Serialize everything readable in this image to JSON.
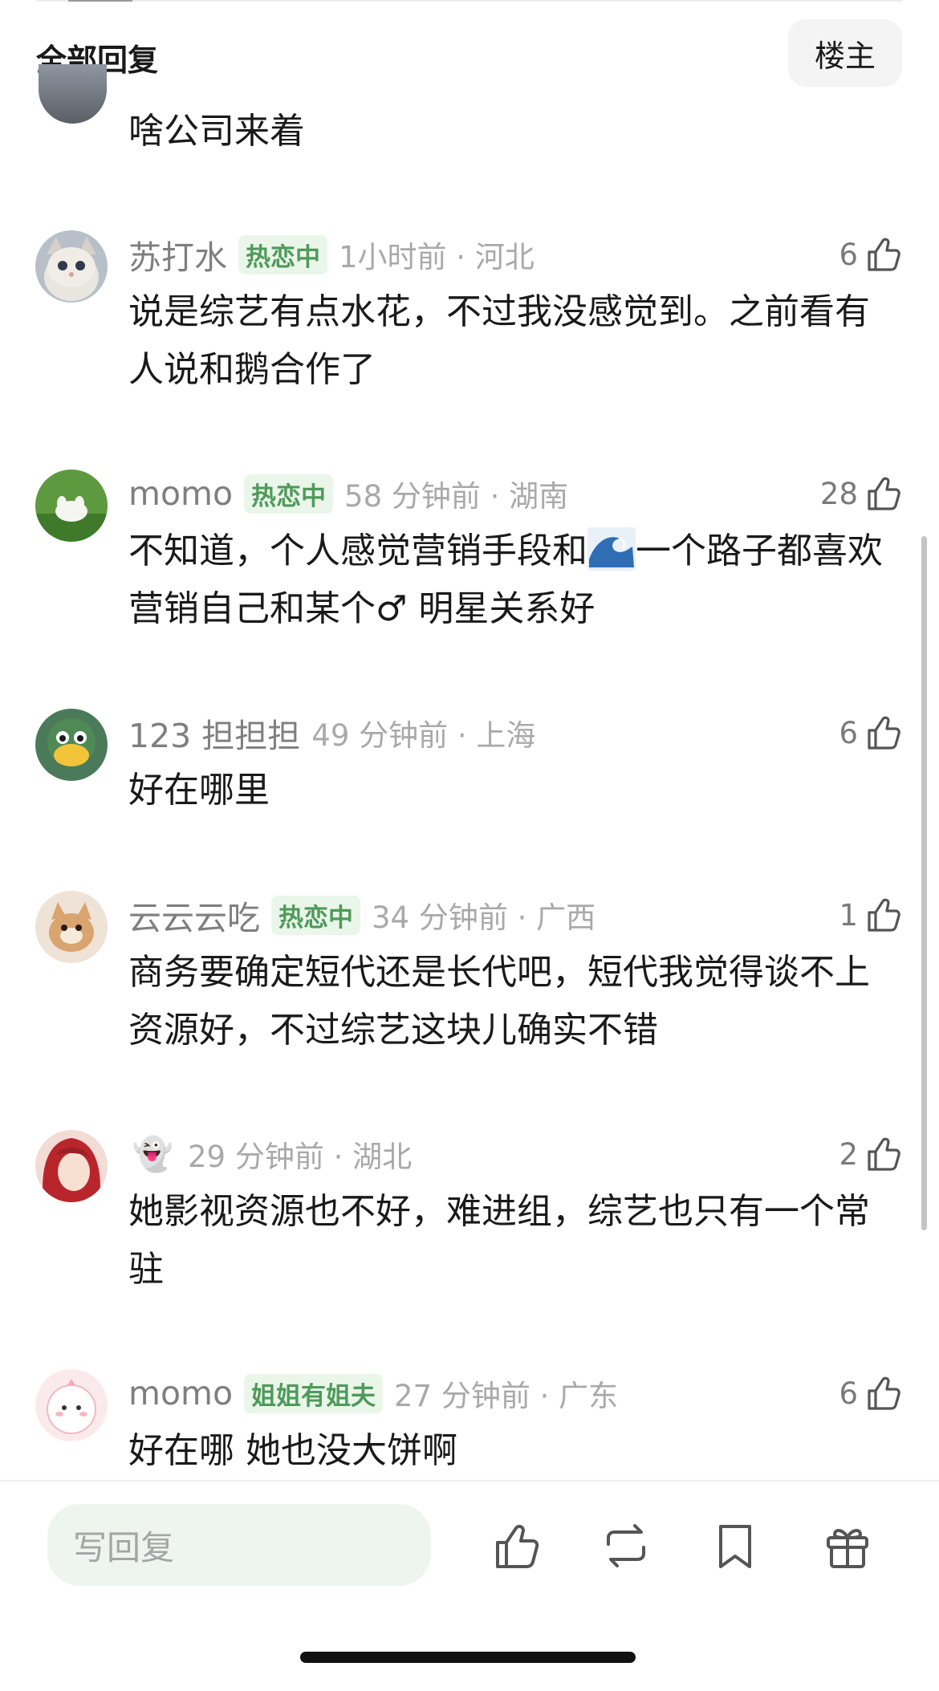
{
  "header": {
    "title": "全部回复",
    "op_button": "楼主"
  },
  "partial_comment": {
    "text": "啥公司来着"
  },
  "comments": [
    {
      "username": "苏打水",
      "badge": "热恋中",
      "time": "1小时前 · 河北",
      "likes": "6",
      "text": "说是综艺有点水花，不过我没感觉到。之前看有人说和鹅合作了"
    },
    {
      "username": "momo",
      "badge": "热恋中",
      "time": "58 分钟前 · 湖南",
      "likes": "28",
      "text_before": "不知道，个人感觉营销手段和",
      "text_after": "一个路子都喜欢营销自己和某个♂ 明星关系好"
    },
    {
      "username": "123 担担担",
      "badge": "",
      "time": "49 分钟前 · 上海",
      "likes": "6",
      "text": "好在哪里"
    },
    {
      "username": "云云云吃",
      "badge": "热恋中",
      "time": "34 分钟前 · 广西",
      "likes": "1",
      "text": "商务要确定短代还是长代吧，短代我觉得谈不上资源好，不过综艺这块儿确实不错"
    },
    {
      "username": "👻",
      "badge": "",
      "time": "29 分钟前 · 湖北",
      "likes": "2",
      "text": "她影视资源也不好，难进组，综艺也只有一个常驻"
    },
    {
      "username": "momo",
      "badge": "姐姐有姐夫",
      "time": "27 分钟前 · 广东",
      "likes": "6",
      "text": "好在哪 她也没大饼啊"
    }
  ],
  "bottom_bar": {
    "reply_placeholder": "写回复"
  },
  "icons": {
    "like": "thumbs-up-icon",
    "repost": "repost-icon",
    "bookmark": "bookmark-icon",
    "gift": "gift-icon",
    "wave": "wave-emoji-icon"
  },
  "colors": {
    "badge_text": "#4f9a5a",
    "badge_bg": "#eaf6ea",
    "input_bg": "#eef5ef"
  }
}
